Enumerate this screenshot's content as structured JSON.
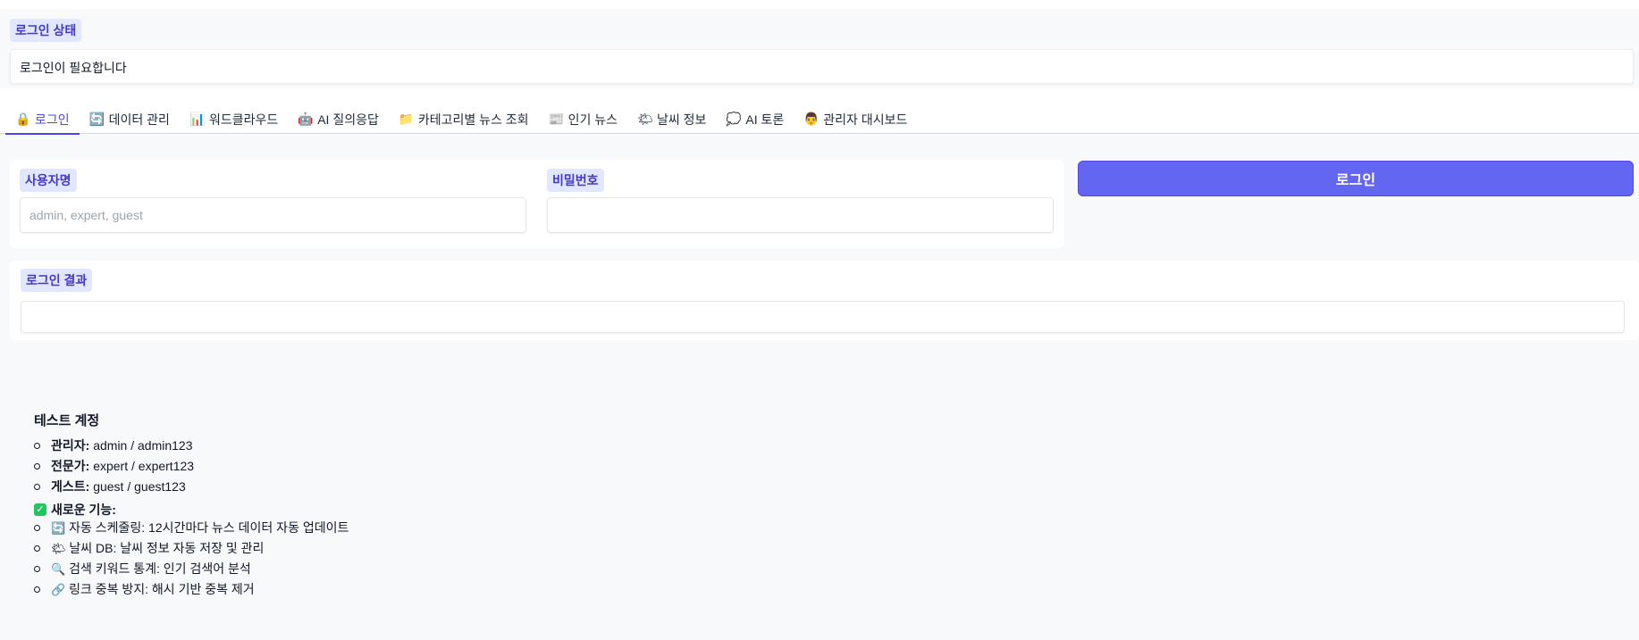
{
  "status": {
    "label": "로그인 상태",
    "value": "로그인이 필요합니다"
  },
  "tabs": [
    {
      "icon": "lock-icon",
      "glyph": "🔒",
      "label": "로그인",
      "active": true
    },
    {
      "icon": "refresh-icon",
      "glyph": "🔄",
      "label": "데이터 관리",
      "active": false
    },
    {
      "icon": "bar-chart-icon",
      "glyph": "📊",
      "label": "워드클라우드",
      "active": false
    },
    {
      "icon": "robot-icon",
      "glyph": "🤖",
      "label": "AI 질의응답",
      "active": false
    },
    {
      "icon": "folder-icon",
      "glyph": "📁",
      "label": "카테고리별 뉴스 조회",
      "active": false
    },
    {
      "icon": "newspaper-icon",
      "glyph": "📰",
      "label": "인기 뉴스",
      "active": false
    },
    {
      "icon": "weather-icon",
      "glyph": "🌤",
      "label": "날씨 정보",
      "active": false
    },
    {
      "icon": "speech-bubble-icon",
      "glyph": "💭",
      "label": "AI 토론",
      "active": false
    },
    {
      "icon": "admin-icon",
      "glyph": "👨",
      "label": "관리자 대시보드",
      "active": false
    }
  ],
  "form": {
    "username_label": "사용자명",
    "username_placeholder": "admin, expert, guest",
    "username_value": "",
    "password_label": "비밀번호",
    "password_value": "",
    "login_button": "로그인"
  },
  "result": {
    "label": "로그인 결과",
    "value": ""
  },
  "info": {
    "heading": "테스트 계정",
    "accounts": [
      {
        "role": "관리자:",
        "creds": "admin / admin123"
      },
      {
        "role": "전문가:",
        "creds": "expert / expert123"
      },
      {
        "role": "게스트:",
        "creds": "guest / guest123"
      }
    ],
    "features_heading": "새로운 기능:",
    "features": [
      {
        "icon": "refresh-icon",
        "glyph": "🔄",
        "text": "자동 스케줄링: 12시간마다 뉴스 데이터 자동 업데이트"
      },
      {
        "icon": "weather-icon",
        "glyph": "🌤",
        "text": "날씨 DB: 날씨 정보 자동 저장 및 관리"
      },
      {
        "icon": "magnifier-icon",
        "glyph": "🔍",
        "text": "검색 키워드 통계: 인기 검색어 분석"
      },
      {
        "icon": "link-icon",
        "glyph": "🔗",
        "text": "링크 중복 방지: 해시 기반 중복 제거"
      }
    ]
  },
  "colors": {
    "accent": "#6366f1",
    "chip_bg": "#e0e7ff",
    "chip_text": "#4338ca",
    "panel_bg": "#f8f9fb"
  }
}
